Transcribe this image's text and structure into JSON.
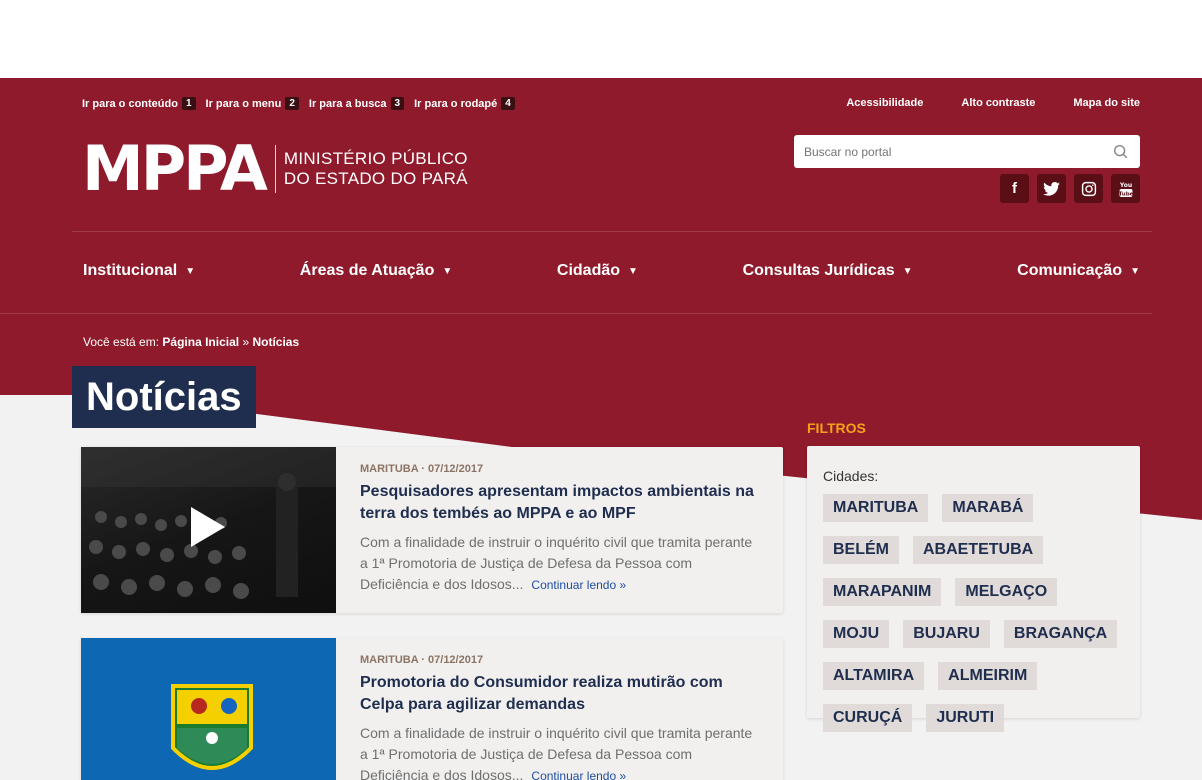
{
  "skip_links": [
    {
      "label": "Ir para o conteúdo",
      "key": "1"
    },
    {
      "label": "Ir para o menu",
      "key": "2"
    },
    {
      "label": "Ir para a busca",
      "key": "3"
    },
    {
      "label": "Ir para o rodapé",
      "key": "4"
    }
  ],
  "utility_links": [
    "Acessibilidade",
    "Alto contraste",
    "Mapa do site"
  ],
  "logo": {
    "mark": "MPPA",
    "line1": "MINISTÉRIO PÚBLICO",
    "line2": "DO ESTADO DO PARÁ"
  },
  "search": {
    "placeholder": "Buscar no portal"
  },
  "social": [
    "facebook-icon",
    "twitter-icon",
    "instagram-icon",
    "youtube-icon"
  ],
  "nav": [
    "Institucional",
    "Áreas de Atuação",
    "Cidadão",
    "Consultas Jurídicas",
    "Comunicação"
  ],
  "breadcrumb": {
    "prefix": "Você está em:",
    "home": "Página Inicial",
    "sep": "»",
    "current": "Notícias"
  },
  "page_title": "Notícias",
  "news": [
    {
      "meta": "MARITUBA · 07/12/2017",
      "headline": "Pesquisadores apresentam impactos ambientais na terra dos tembés ao MPPA e ao MPF",
      "excerpt": "Com a finalidade de instruir o inquérito civil que tramita perante a 1ª Promotoria de Justiça de Defesa da Pessoa com Deficiência e dos Idosos...",
      "more": "Continuar lendo »"
    },
    {
      "meta": "MARITUBA · 07/12/2017",
      "headline": "Promotoria do Consumidor realiza mutirão com Celpa para agilizar demandas",
      "excerpt": "Com a finalidade de instruir o inquérito civil que tramita perante a 1ª Promotoria de Justiça de Defesa da Pessoa com Deficiência e dos Idosos...",
      "more": "Continuar lendo »"
    }
  ],
  "filters": {
    "title": "FILTROS",
    "label": "Cidades:",
    "cities": [
      "MARITUBA",
      "MARABÁ",
      "BELÉM",
      "ABAETETUBA",
      "MARAPANIM",
      "MELGAÇO",
      "MOJU",
      "BUJARU",
      "BRAGANÇA",
      "ALTAMIRA",
      "ALMEIRIM",
      "CURUÇÁ",
      "JURUTI"
    ]
  }
}
